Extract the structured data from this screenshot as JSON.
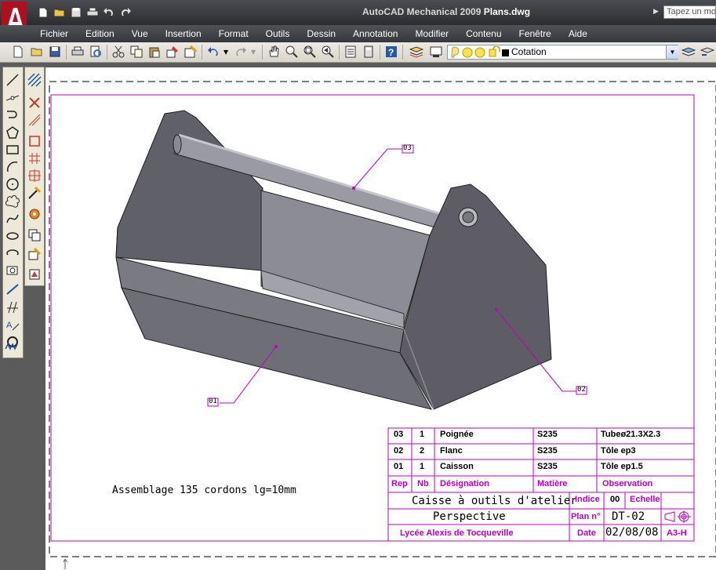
{
  "app": {
    "title_prefix": "AutoCAD Mechanical 2009",
    "file_name": "Plans.dwg",
    "search_placeholder": "Tapez un mot"
  },
  "menu": [
    "Fichier",
    "Edition",
    "Vue",
    "Insertion",
    "Format",
    "Outils",
    "Dessin",
    "Annotation",
    "Modifier",
    "Contenu",
    "Fenêtre",
    "Aide"
  ],
  "layer": {
    "name": "Cotation"
  },
  "drawing": {
    "note": "Assemblage 135 cordons lg=10mm",
    "callouts": [
      "01",
      "02",
      "03"
    ],
    "parts_list": [
      {
        "rep": "03",
        "nb": "1",
        "designation": "Poignée",
        "matiere": "S235",
        "observation": "Tubeø21.3X2.3"
      },
      {
        "rep": "02",
        "nb": "2",
        "designation": "Flanc",
        "matiere": "S235",
        "observation": "Tôle ep3"
      },
      {
        "rep": "01",
        "nb": "1",
        "designation": "Caisson",
        "matiere": "S235",
        "observation": "Tôle ep1.5"
      }
    ],
    "headers": {
      "rep": "Rep",
      "nb": "Nb",
      "designation": "Désignation",
      "matiere": "Matière",
      "observation": "Observation"
    },
    "title": "Caisse à outils d'atelier",
    "view": "Perspective",
    "school": "Lycée Alexis de Tocqueville",
    "indice_label": "Indice",
    "indice": "00",
    "echelle_label": "Echelle",
    "plan_label": "Plan n°",
    "plan": "DT-02",
    "date_label": "Date",
    "date": "02/08/08",
    "format": "A3-H"
  },
  "colors": {
    "accent": "#c000c0",
    "body": "#6b6a70",
    "face_dark": "#55545c",
    "logo": "#c8102e"
  }
}
